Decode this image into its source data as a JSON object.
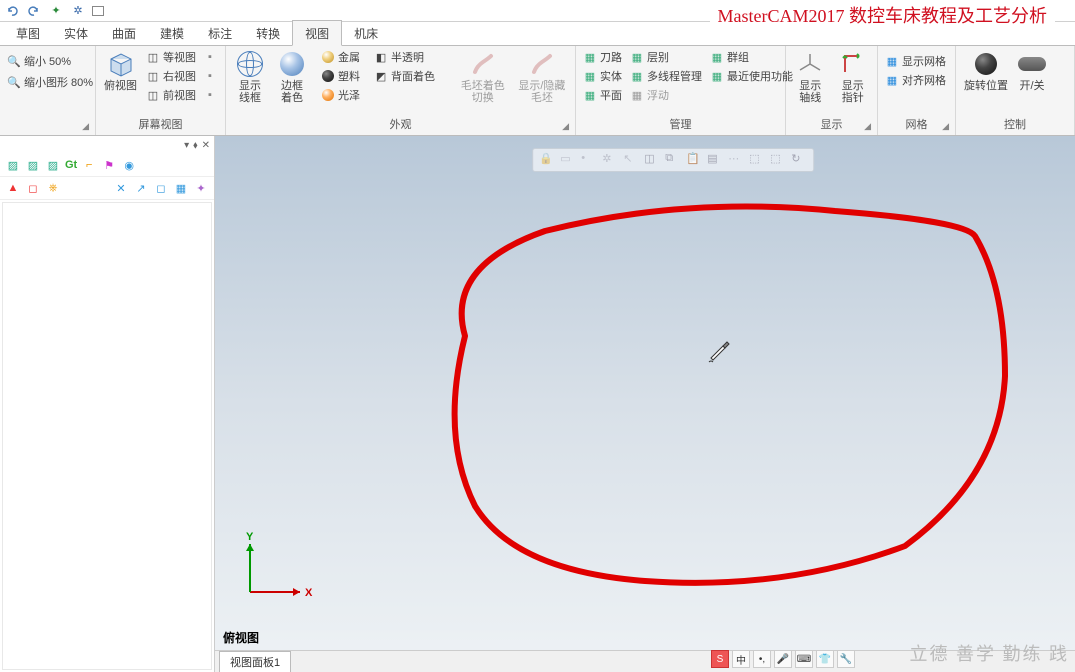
{
  "title_banner": "MasterCAM2017 数控车床教程及工艺分析",
  "tabs": [
    "草图",
    "实体",
    "曲面",
    "建模",
    "标注",
    "转换",
    "视图",
    "机床"
  ],
  "active_tab": "视图",
  "qat": {
    "zoom_out": "缩小 50%",
    "shrink_shape": "缩小图形 80%"
  },
  "ribbon": {
    "group1": {
      "label": "屏幕视图",
      "big": "俯视图",
      "items": [
        "等视图",
        "右视图",
        "前视图"
      ]
    },
    "group2": {
      "label": "外观",
      "wireframe": "显示线框",
      "edgecolor": "边框着色",
      "metal": "金属",
      "plastic": "塑料",
      "gloss": "光泽",
      "semitrans": "半透明",
      "backcolor": "背面着色",
      "blank_toggle": "毛坯着色切换",
      "show_hide_blank": "显示/隐藏毛坯"
    },
    "group3": {
      "label": "管理",
      "toolpath": "刀路",
      "layer": "层别",
      "group": "群组",
      "solid": "实体",
      "multithread": "多线程管理",
      "recent": "最近使用功能",
      "plane": "平面",
      "float": "浮动"
    },
    "group4": {
      "label": "显示",
      "axes": "显示轴线",
      "pointer": "显示指针"
    },
    "group5": {
      "label": "网格",
      "show": "显示网格",
      "snap": "对齐网格"
    },
    "group6": {
      "label": "控制",
      "rotpos": "旋转位置",
      "onoff": "开/关"
    }
  },
  "viewport": {
    "view_name": "俯视图",
    "view_tab": "视图面板1",
    "axis_x": "X",
    "axis_y": "Y"
  },
  "sidepanel": {
    "gt": "Gt"
  },
  "ime": {
    "s": "S",
    "zhong": "中"
  },
  "watermark": "立德 善学 勤练 践"
}
